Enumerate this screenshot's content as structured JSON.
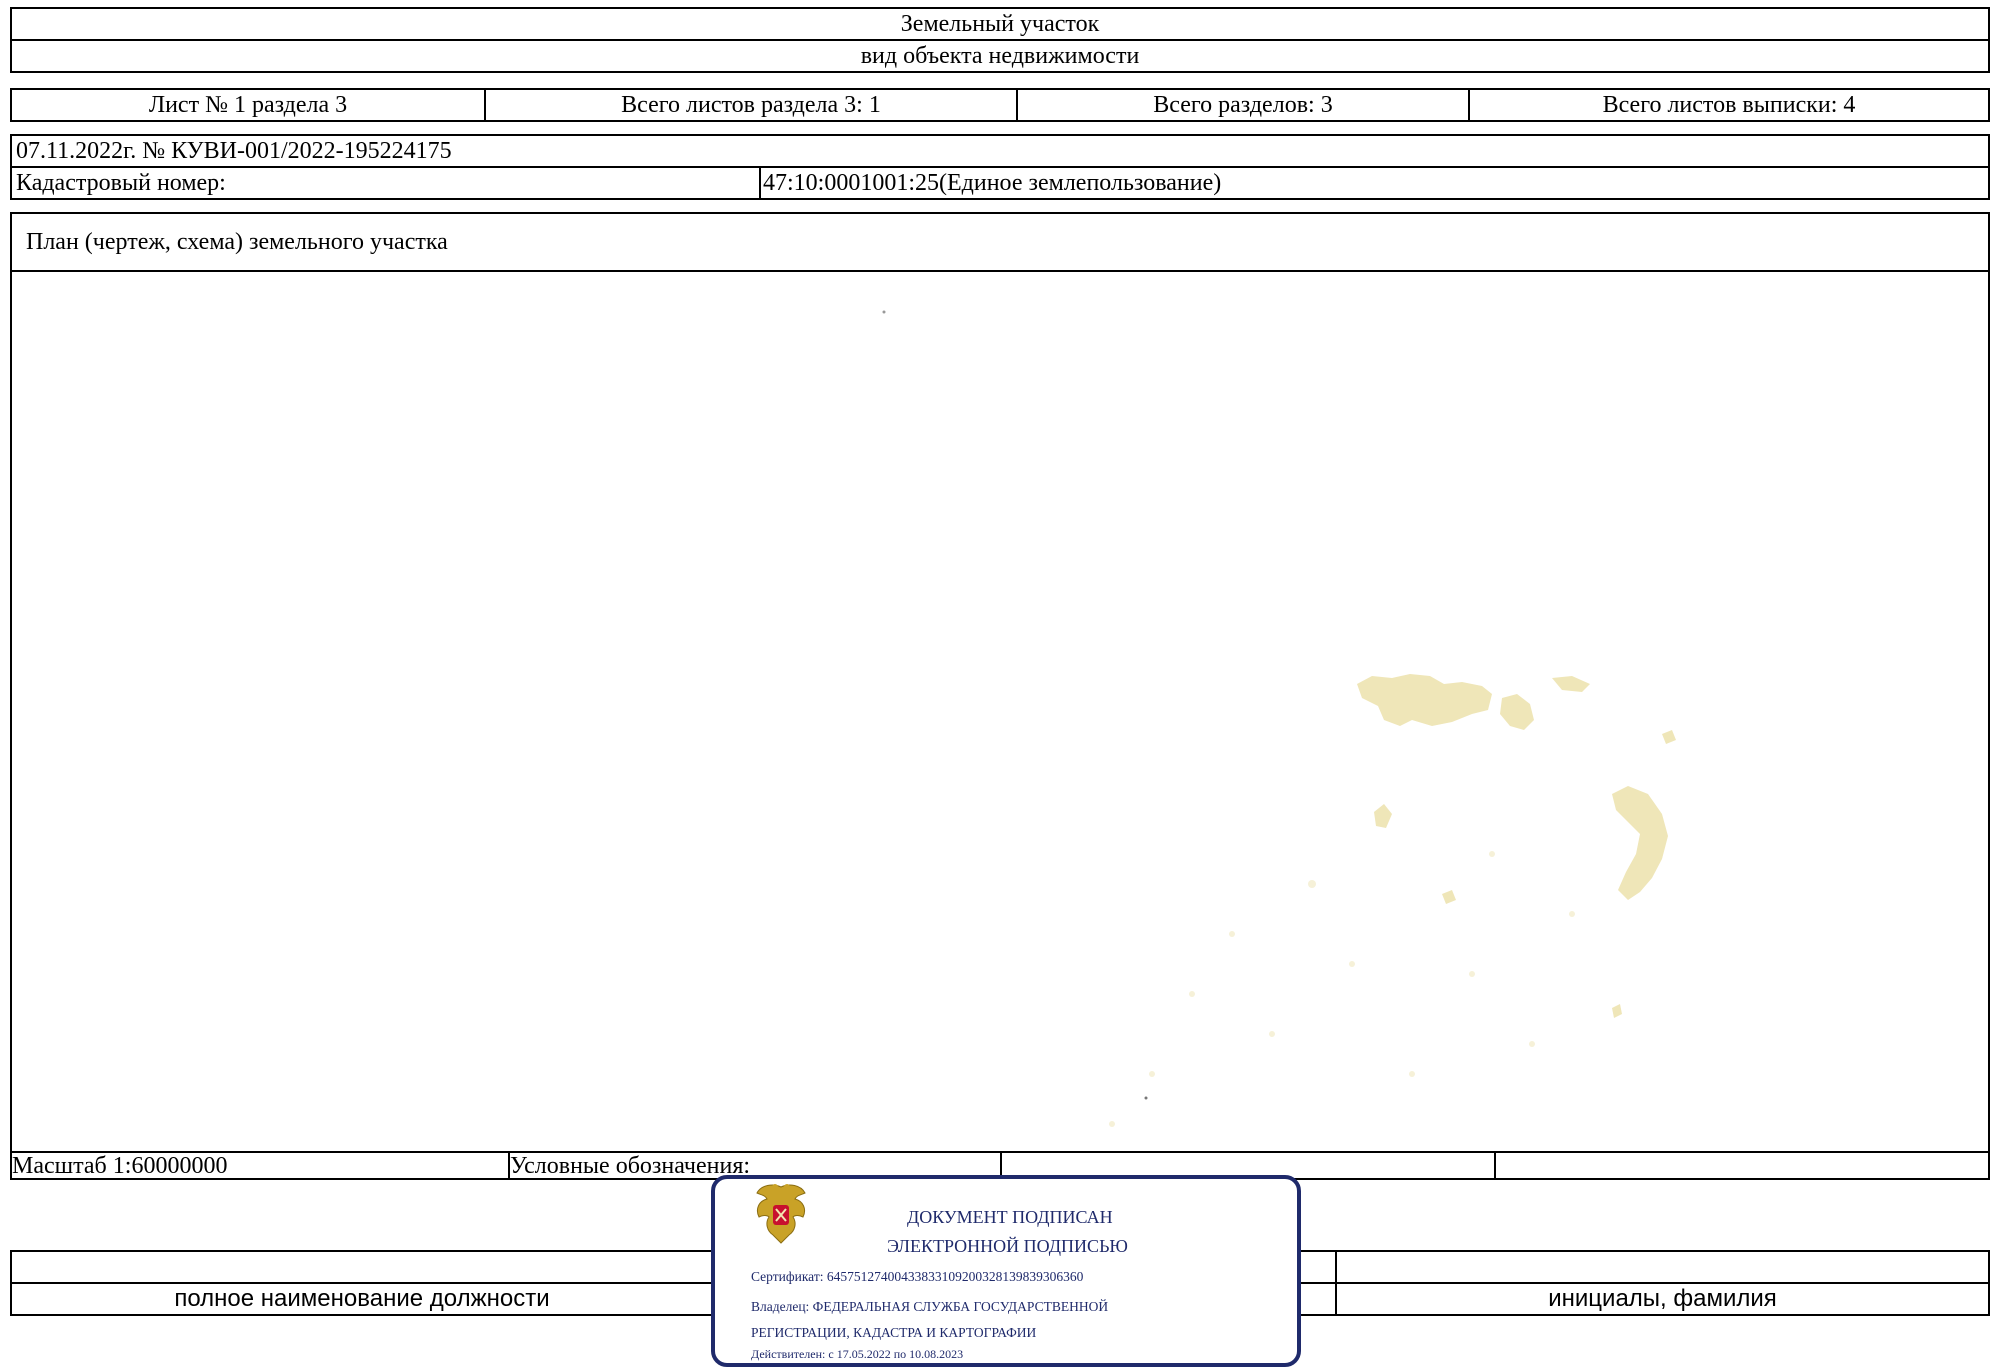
{
  "header": {
    "object_name": "Земельный участок",
    "object_kind_caption": "вид объекта недвижимости"
  },
  "sheet_info": {
    "sheet": "Лист № 1 раздела 3",
    "section_sheets": "Всего листов раздела 3: 1",
    "sections_total": "Всего разделов: 3",
    "extract_sheets": "Всего листов выписки: 4"
  },
  "document": {
    "date_number": "07.11.2022г. № КУВИ-001/2022-195224175",
    "cadastral_label": "Кадастровый номер:",
    "cadastral_value": "47:10:0001001:25(Единое землепользование)"
  },
  "plan": {
    "title": "План (чертеж, схема) земельного участка"
  },
  "footer_row": {
    "scale": "Масштаб 1:60000000",
    "legend": "Условные обозначения:"
  },
  "signature": {
    "position_caption": "полное наименование должности",
    "name_caption": "инициалы, фамилия"
  },
  "stamp": {
    "line1": "ДОКУМЕНТ ПОДПИСАН",
    "line2": "ЭЛЕКТРОННОЙ ПОДПИСЬЮ",
    "certificate": "Сертификат: 645751274004338331092003281398393063​60",
    "owner_line1": "Владелец: ФЕДЕРАЛЬНАЯ СЛУЖБА ГОСУДАРСТВЕННОЙ",
    "owner_line2": "РЕГИСТРАЦИИ, КАДАСТРА И КАРТОГРАФИИ",
    "valid": "Действителен: с 17.05.2022 по 10.08.2023",
    "color": "#1f2a6b"
  },
  "colors": {
    "map_fill": "#efe6b8"
  }
}
